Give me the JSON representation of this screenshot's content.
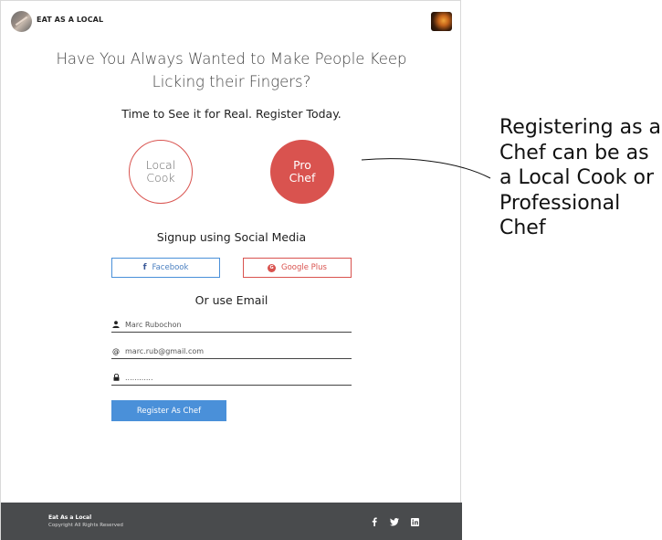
{
  "header": {
    "brand": "EAT AS A LOCAL"
  },
  "hero": {
    "headline": "Have You Always Wanted to Make People Keep Licking their Fingers?",
    "subhead": "Time to See it for Real. Register Today."
  },
  "roles": [
    {
      "label": "Local Cook",
      "selected": false
    },
    {
      "label": "Pro Chef",
      "selected": true
    }
  ],
  "annotation": "Registering as a Chef can be as a Local Cook or Professional Chef",
  "social": {
    "title": "Signup using Social Media",
    "facebook_label": "Facebook",
    "google_label": "Google Plus"
  },
  "email": {
    "title": "Or use Email",
    "name_value": "Marc Rubochon",
    "email_value": "marc.rub@gmail.com",
    "password_value": "............"
  },
  "register_label": "Register As Chef",
  "footer": {
    "brand": "Eat As a Local",
    "copyright": "Copyright All Rights Reserved",
    "icons": [
      "facebook-icon",
      "twitter-icon",
      "linkedin-icon"
    ]
  },
  "colors": {
    "accent_red": "#d9534f",
    "accent_blue": "#4a90d9",
    "footer_bg": "#494b4d"
  }
}
